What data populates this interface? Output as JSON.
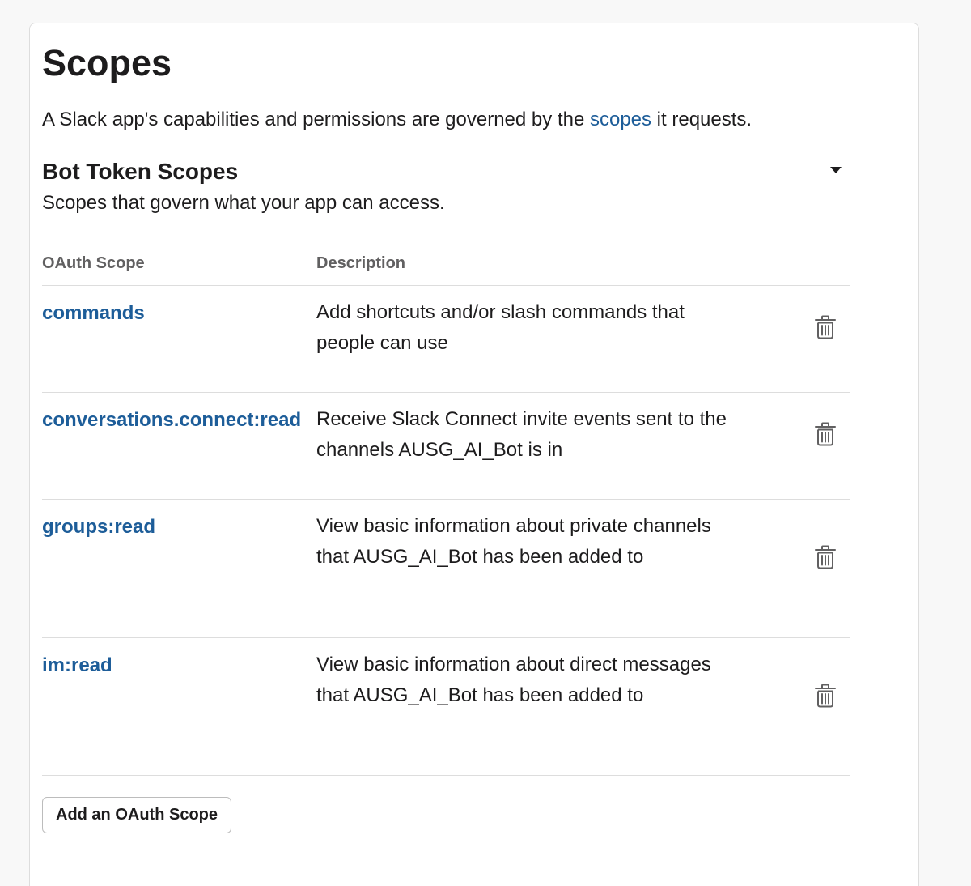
{
  "page": {
    "title": "Scopes",
    "intro_before_link": "A Slack app's capabilities and permissions are governed by the ",
    "intro_link": "scopes",
    "intro_after_link": " it requests."
  },
  "section": {
    "title": "Bot Token Scopes",
    "subtitle": "Scopes that govern what your app can access.",
    "toggle_icon": "caret-down-icon"
  },
  "table": {
    "headers": {
      "scope": "OAuth Scope",
      "description": "Description"
    },
    "rows": [
      {
        "scope": "commands",
        "description": "Add shortcuts and/or slash commands that people can use",
        "action_icon": "trash-icon"
      },
      {
        "scope": "conversations.connect:read",
        "description": "Receive Slack Connect invite events sent to the channels AUSG_AI_Bot is in",
        "action_icon": "trash-icon"
      },
      {
        "scope": "groups:read",
        "description": "View basic information about private channels that AUSG_AI_Bot has been added to",
        "action_icon": "trash-icon"
      },
      {
        "scope": "im:read",
        "description": "View basic information about direct messages that AUSG_AI_Bot has been added to",
        "action_icon": "trash-icon"
      }
    ]
  },
  "actions": {
    "add_scope_label": "Add an OAuth Scope"
  },
  "colors": {
    "link": "#1d5d99",
    "text": "#1d1c1d",
    "muted": "#616061",
    "divider": "#dddddd",
    "background": "#f8f8f8",
    "card": "#ffffff"
  }
}
